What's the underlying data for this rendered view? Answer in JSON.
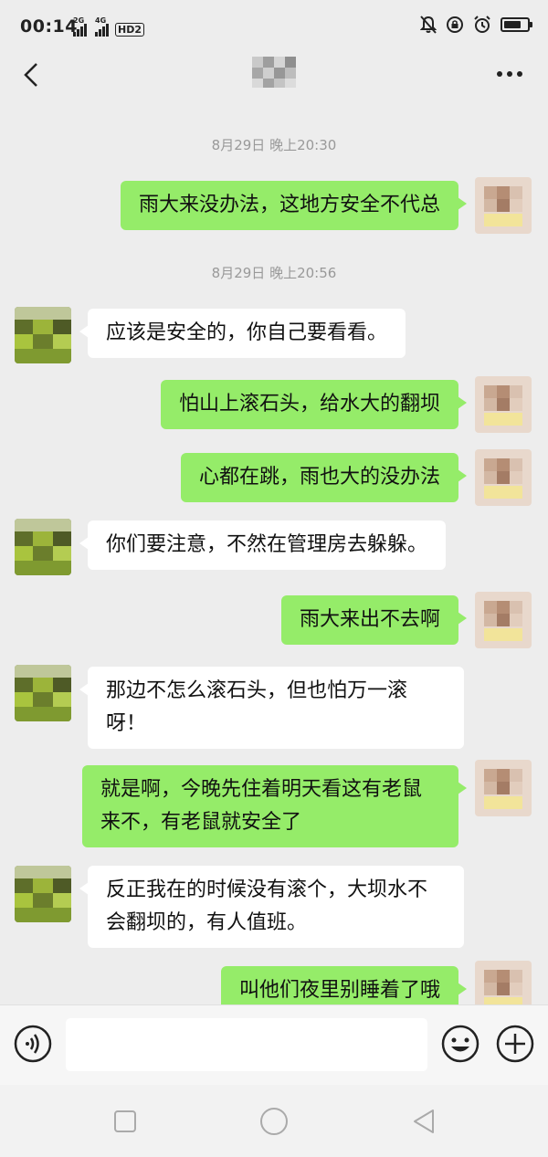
{
  "status_bar": {
    "time": "00:14",
    "network_1": "2G",
    "network_2": "4G",
    "hd_label": "HD2",
    "battery_level": 0.75
  },
  "nav": {
    "title": ""
  },
  "timestamps": [
    "8月29日 晚上20:30",
    "8月29日 晚上20:56"
  ],
  "messages": [
    {
      "side": "sent",
      "text": "雨大来没办法，这地方安全不代总"
    },
    {
      "side": "recv",
      "text": "应该是安全的，你自己要看看。"
    },
    {
      "side": "sent",
      "text": "怕山上滚石头，给水大的翻坝"
    },
    {
      "side": "sent",
      "text": "心都在跳，雨也大的没办法"
    },
    {
      "side": "recv",
      "text": "你们要注意，不然在管理房去躲躲。"
    },
    {
      "side": "sent",
      "text": "雨大来出不去啊"
    },
    {
      "side": "recv",
      "text": "那边不怎么滚石头，但也怕万一滚呀！"
    },
    {
      "side": "sent",
      "text": "就是啊，今晚先住着明天看这有老鼠来不，有老鼠就安全了"
    },
    {
      "side": "recv",
      "text": "反正我在的时候没有滚个，大坝水不会翻坝的，有人值班。"
    },
    {
      "side": "sent",
      "text": "叫他们夜里别睡着了哦"
    }
  ],
  "input": {
    "placeholder": "",
    "value": ""
  },
  "colors": {
    "sent_bubble": "#95ec69",
    "recv_bubble": "#ffffff",
    "background": "#ededed"
  }
}
